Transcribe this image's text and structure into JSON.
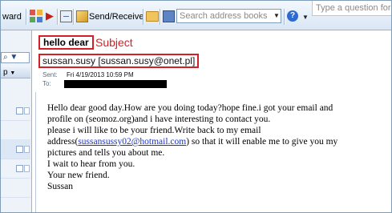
{
  "toolbar": {
    "ward_fragment": "ward",
    "send_receive_label": "Send/Receive",
    "search_placeholder": "Search address books",
    "help_question_placeholder": "Type a question for help"
  },
  "nav": {
    "row_label": "p"
  },
  "message": {
    "subject": "hello dear",
    "subject_annotation": "Subject",
    "from": "sussan.susy [sussan.susy@onet.pl]",
    "sent_label": "Sent:",
    "sent_value": "Fri 4/19/2013 10:59 PM",
    "to_label": "To:",
    "body": {
      "line1": "Hello dear good day.How are you doing today?hope fine.i got your email and",
      "line2": "profile on (seomoz.org)and i have interesting to contact you.",
      "line3": "please i will like to be your friend.Write back to my email",
      "line4_prefix": "address(",
      "email_link": "sussansussy02@hotmail.com",
      "line4_suffix": ") so that it will enable me to give you my",
      "line5": "pictures and tells you about me.",
      "line6": "I wait to hear from you.",
      "line7": "Your new friend.",
      "line8": "Sussan"
    }
  },
  "icons": [
    "categorize-icon",
    "flag-icon",
    "rules-icon",
    "send-receive-icon",
    "folder-icon",
    "address-book-icon",
    "help-icon"
  ],
  "colors": {
    "annotation_red": "#d32027",
    "link_blue": "#1a33c4",
    "toolbar_top": "#f3f8fd",
    "toolbar_bottom": "#d9e6f4"
  }
}
